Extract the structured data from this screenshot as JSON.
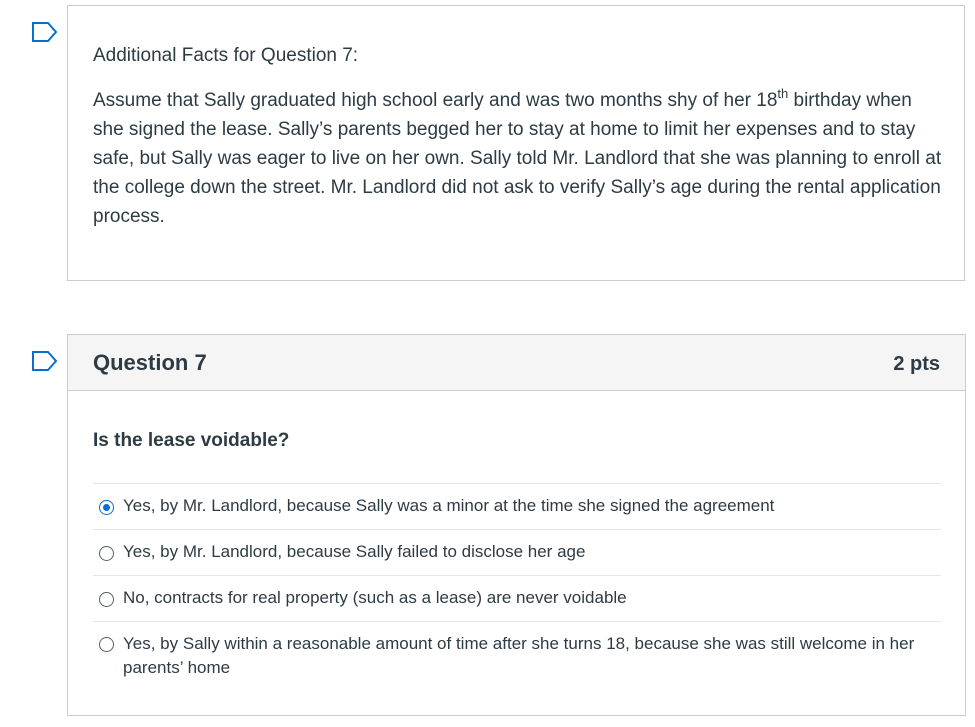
{
  "facts": {
    "title": "Additional Facts for Question 7:",
    "body_part1": "Assume that Sally graduated high school early and was two months shy of her 18",
    "body_sup": "th",
    "body_part2": " birthday when she signed the lease.  Sally’s parents begged her to stay at home to limit her expenses and to stay safe, but Sally was eager to live on her own.  Sally told Mr. Landlord that she was planning to enroll at the college down the street. Mr. Landlord did not ask to verify Sally’s age during the rental application process."
  },
  "question": {
    "title": "Question 7",
    "points": "2 pts",
    "prompt": "Is the lease voidable?",
    "answers": [
      {
        "label": "Yes, by Mr. Landlord, because Sally was a minor at the time she signed the agreement",
        "selected": true
      },
      {
        "label": "Yes, by Mr. Landlord, because Sally failed to disclose her age",
        "selected": false
      },
      {
        "label": "No, contracts for real property (such as a lease) are never voidable",
        "selected": false
      },
      {
        "label": "Yes, by Sally within a reasonable amount of time after she turns 18, because she was still welcome in her parents’ home",
        "selected": false
      }
    ]
  },
  "icons": {
    "flag": "bookmark-flag-icon",
    "radio_checked": "radio-checked-icon",
    "radio_unchecked": "radio-unchecked-icon"
  },
  "colors": {
    "accent": "#0770cf",
    "text": "#2d3b45",
    "border": "#c7cdd1",
    "header_bg": "#f5f5f5"
  }
}
